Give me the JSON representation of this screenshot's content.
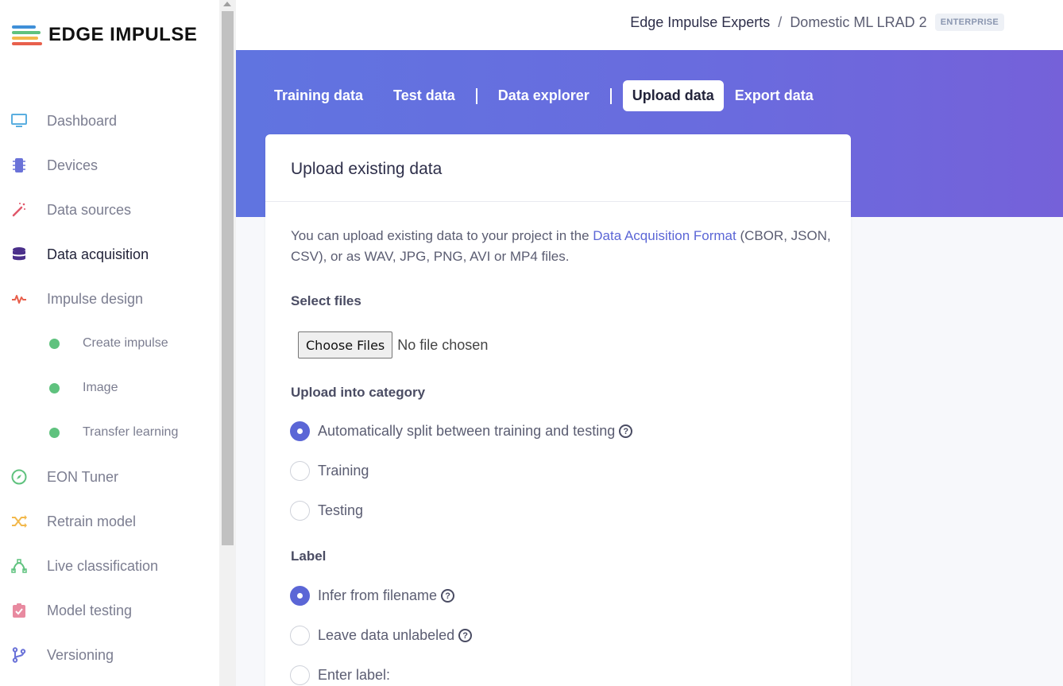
{
  "brand": {
    "name": "EDGE IMPULSE",
    "colors": [
      "#3f8fd8",
      "#5fc27e",
      "#f2b84b",
      "#e8604c"
    ]
  },
  "sidebar": {
    "items": [
      {
        "label": "Dashboard",
        "icon": "monitor-icon",
        "color": "#5aaee0"
      },
      {
        "label": "Devices",
        "icon": "chip-icon",
        "color": "#6a72d8"
      },
      {
        "label": "Data sources",
        "icon": "magic-wand-icon",
        "color": "#e0576a"
      },
      {
        "label": "Data acquisition",
        "icon": "database-icon",
        "color": "#4a2f8a",
        "active": true
      },
      {
        "label": "Impulse design",
        "icon": "pulse-icon",
        "color": "#e8604c"
      },
      {
        "label": "Create impulse",
        "sub": true
      },
      {
        "label": "Image",
        "sub": true
      },
      {
        "label": "Transfer learning",
        "sub": true
      },
      {
        "label": "EON Tuner",
        "icon": "compass-icon",
        "color": "#5fc27e"
      },
      {
        "label": "Retrain model",
        "icon": "shuffle-icon",
        "color": "#f2b84b"
      },
      {
        "label": "Live classification",
        "icon": "curve-icon",
        "color": "#5fc27e"
      },
      {
        "label": "Model testing",
        "icon": "clipboard-check-icon",
        "color": "#e88aa0"
      },
      {
        "label": "Versioning",
        "icon": "git-branch-icon",
        "color": "#6a72d8"
      }
    ]
  },
  "header": {
    "org": "Edge Impulse Experts",
    "separator": "/",
    "project": "Domestic ML LRAD 2",
    "badge": "ENTERPRISE"
  },
  "tabs": [
    {
      "label": "Training data"
    },
    {
      "label": "Test data"
    },
    {
      "label": "Data explorer"
    },
    {
      "label": "Upload data",
      "active": true
    },
    {
      "label": "Export data"
    }
  ],
  "card": {
    "title": "Upload existing data",
    "description_pre": "You can upload existing data to your project in the ",
    "description_link": "Data Acquisition Format",
    "description_post": " (CBOR, JSON, CSV), or as WAV, JPG, PNG, AVI or MP4 files.",
    "select_files_label": "Select files",
    "choose_files_button": "Choose Files",
    "file_status": "No file chosen",
    "category_label": "Upload into category",
    "category_options": [
      {
        "label": "Automatically split between training and testing",
        "selected": true,
        "help": true
      },
      {
        "label": "Training",
        "selected": false
      },
      {
        "label": "Testing",
        "selected": false
      }
    ],
    "label_section": "Label",
    "label_options": [
      {
        "label": "Infer from filename",
        "selected": true,
        "help": true
      },
      {
        "label": "Leave data unlabeled",
        "selected": false,
        "help": true
      },
      {
        "label": "Enter label:",
        "selected": false
      }
    ]
  }
}
